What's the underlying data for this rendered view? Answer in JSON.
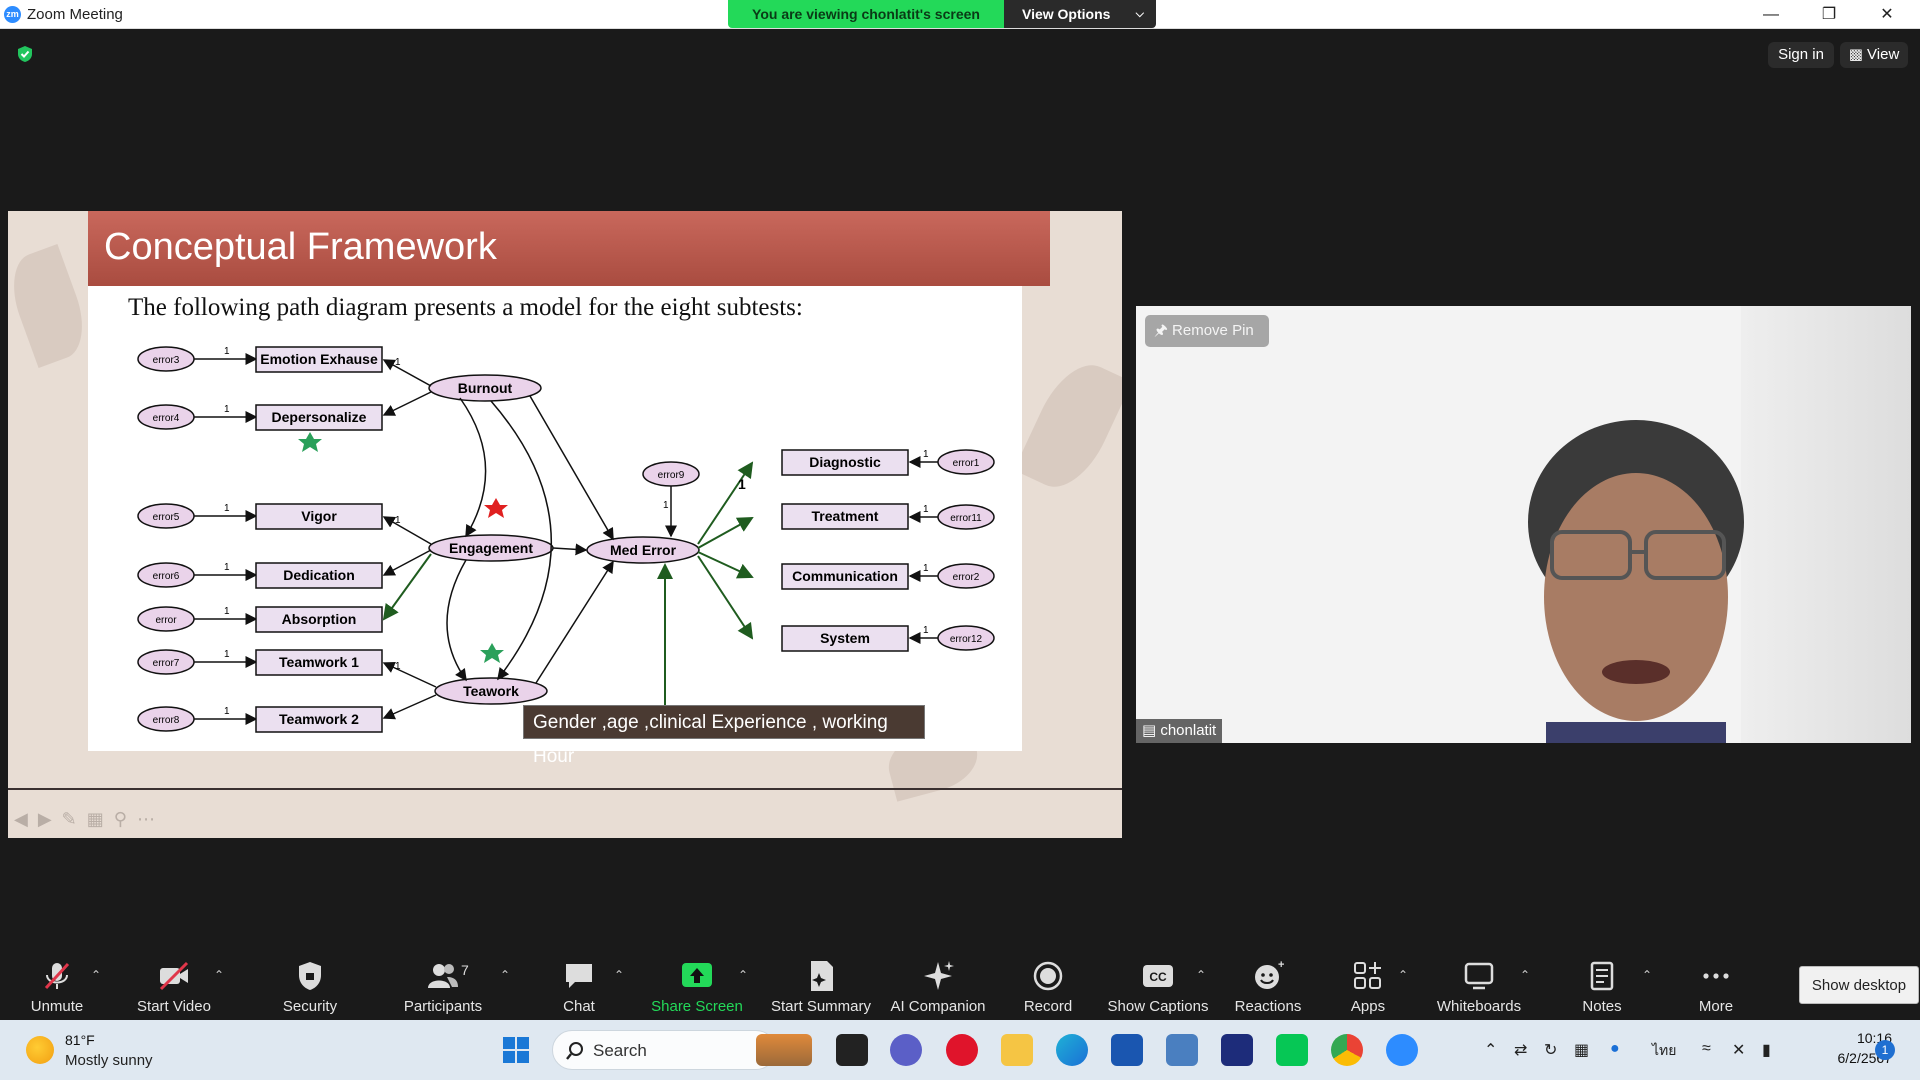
{
  "window": {
    "title": "Zoom Meeting",
    "viewing_banner": "You are viewing chonlatit's screen",
    "view_options": "View Options",
    "sign_in": "Sign in",
    "view": "View"
  },
  "slide": {
    "title": "Conceptual Framework",
    "subtitle": "The following path diagram presents a model for the eight subtests:",
    "caption": "Gender ,age ,clinical Experience , working Hour"
  },
  "diagram": {
    "latent": [
      "Burnout",
      "Engagement",
      "Teawork",
      "Med Error"
    ],
    "observed_left": [
      "Emotion Exhause",
      "Depersonalize",
      "Vigor",
      "Dedication",
      "Absorption",
      "Teamwork 1",
      "Teamwork 2"
    ],
    "errors_left": [
      "error3",
      "error4",
      "error5",
      "error6",
      "error",
      "error7",
      "error8"
    ],
    "observed_right": [
      "Diagnostic",
      "Treatment",
      "Communication",
      "System"
    ],
    "errors_right": [
      "error1",
      "error11",
      "error2",
      "error12"
    ],
    "error_med": "error9",
    "loading_label": "1",
    "big_loading_label": "1"
  },
  "video": {
    "remove_pin": "Remove Pin",
    "participant": "chonlatit"
  },
  "toolbar": {
    "unmute": "Unmute",
    "start_video": "Start Video",
    "security": "Security",
    "participants": "Participants",
    "participants_count": "7",
    "chat": "Chat",
    "share_screen": "Share Screen",
    "start_summary": "Start Summary",
    "ai_companion": "AI Companion",
    "record": "Record",
    "show_captions": "Show Captions",
    "reactions": "Reactions",
    "apps": "Apps",
    "whiteboards": "Whiteboards",
    "notes": "Notes",
    "more": "More",
    "show_desktop": "Show desktop"
  },
  "taskbar": {
    "temp": "81°F",
    "weather": "Mostly sunny",
    "search": "Search",
    "lang": "ไทย",
    "time": "10:16",
    "date": "6/2/2567",
    "notifications": "1"
  }
}
